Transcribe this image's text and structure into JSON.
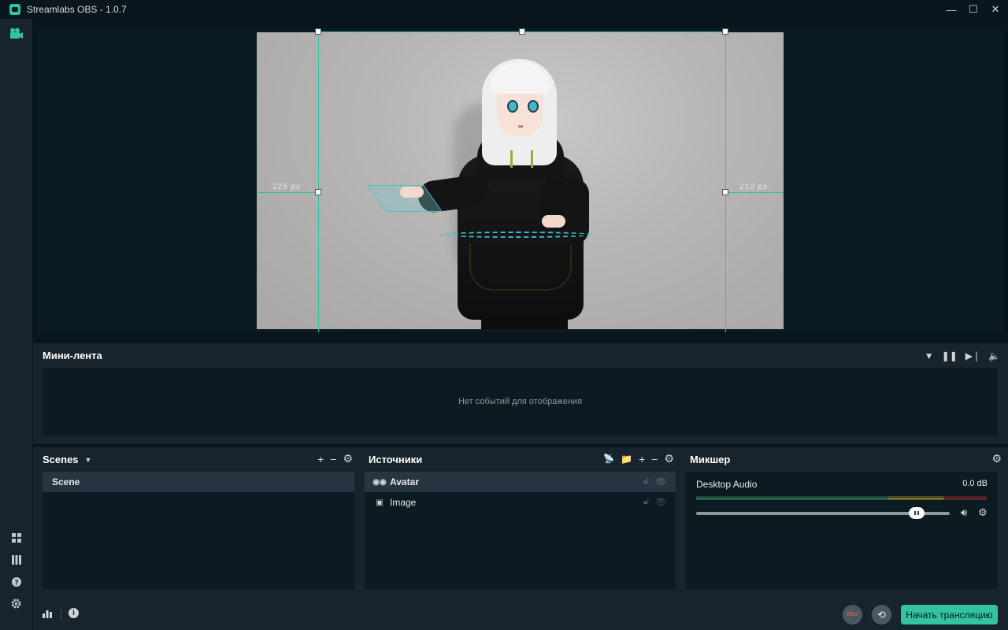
{
  "window": {
    "title": "Streamlabs OBS - 1.0.7",
    "minimize": "—",
    "maximize": "☐",
    "close": "✕"
  },
  "preview": {
    "left_offset_label": "225 px",
    "right_offset_label": "210 px"
  },
  "feed": {
    "title": "Мини-лента",
    "empty_text": "Нет событий для отображения",
    "icons": {
      "filter": "▼",
      "pause": "❚❚",
      "skip": "▶❘",
      "volume": "🔈"
    }
  },
  "scenes": {
    "title": "Scenes",
    "items": [
      "Scene"
    ],
    "selected": 0
  },
  "sources": {
    "title": "Источники",
    "items": [
      {
        "name": "Avatar",
        "icon": "avatar-icon",
        "selected": true
      },
      {
        "name": "Image",
        "icon": "image-icon",
        "selected": false
      }
    ]
  },
  "mixer": {
    "title": "Микшер",
    "channels": [
      {
        "name": "Desktop Audio",
        "level": "0.0 dB",
        "volume": 0.87
      }
    ]
  },
  "footer": {
    "rec_label": "REC",
    "go_live_label": "Начать трансляцию"
  },
  "colors": {
    "accent": "#31c3a2",
    "panel": "#17242d",
    "background": "#09161d"
  }
}
